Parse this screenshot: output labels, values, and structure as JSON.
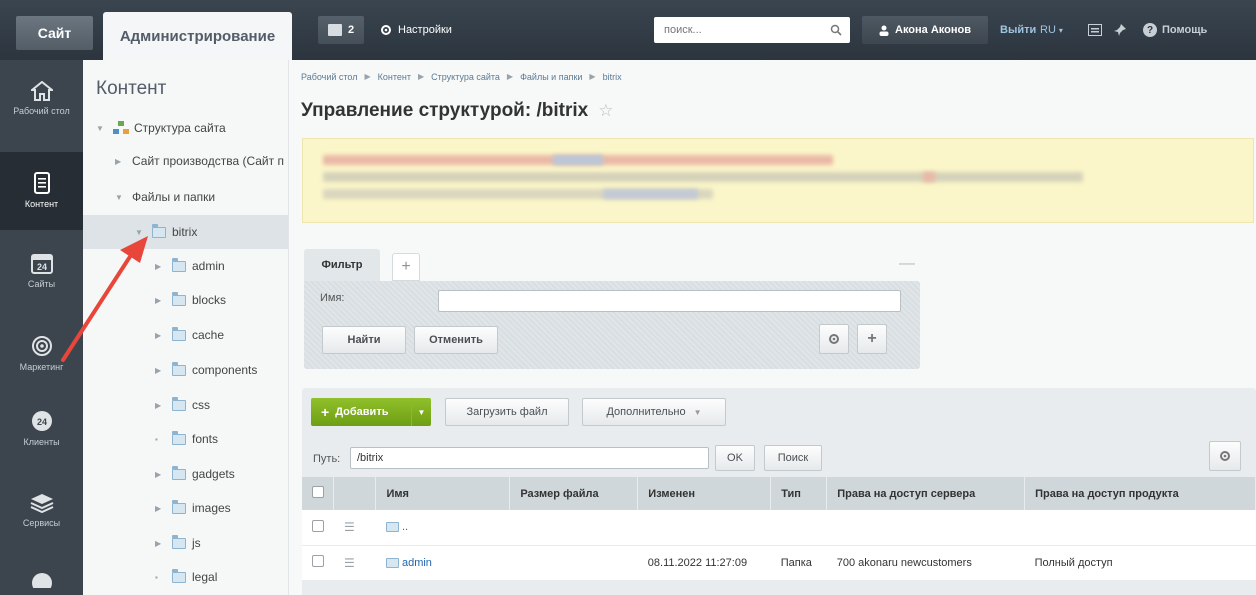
{
  "topbar": {
    "site_tab": "Сайт",
    "admin_tab": "Администрирование",
    "notifications_count": "2",
    "settings_label": "Настройки",
    "search_placeholder": "поиск...",
    "user_name": "Акона Аконов",
    "logout_label": "Выйти",
    "lang_label": "RU",
    "help_label": "Помощь"
  },
  "nav": {
    "items": [
      {
        "label": "Рабочий стол",
        "icon": "home-icon"
      },
      {
        "label": "Контент",
        "icon": "document-icon"
      },
      {
        "label": "Сайты",
        "icon": "calendar-icon"
      },
      {
        "label": "Маркетинг",
        "icon": "target-icon"
      },
      {
        "label": "Клиенты",
        "icon": "clients-icon"
      },
      {
        "label": "Сервисы",
        "icon": "layers-icon"
      }
    ]
  },
  "tree": {
    "title": "Контент",
    "items": [
      {
        "label": "Структура сайта"
      },
      {
        "label": "Сайт производства (Сайт п"
      },
      {
        "label": "Файлы и папки"
      },
      {
        "label": "bitrix"
      },
      {
        "label": "admin"
      },
      {
        "label": "blocks"
      },
      {
        "label": "cache"
      },
      {
        "label": "components"
      },
      {
        "label": "css"
      },
      {
        "label": "fonts"
      },
      {
        "label": "gadgets"
      },
      {
        "label": "images"
      },
      {
        "label": "js"
      },
      {
        "label": "legal"
      }
    ]
  },
  "breadcrumbs": [
    "Рабочий стол",
    "Контент",
    "Структура сайта",
    "Файлы и папки",
    "bitrix"
  ],
  "page_title": "Управление структурой: /bitrix",
  "filter": {
    "tab_label": "Фильтр",
    "add_tab": "+",
    "name_label": "Имя:",
    "name_value": "",
    "find_button": "Найти",
    "cancel_button": "Отменить"
  },
  "toolbar": {
    "add_button": "Добавить",
    "upload_button": "Загрузить файл",
    "more_button": "Дополнительно"
  },
  "path": {
    "label": "Путь:",
    "value": "/bitrix",
    "ok_button": "OK",
    "search_button": "Поиск"
  },
  "table": {
    "columns": [
      "Имя",
      "Размер файла",
      "Изменен",
      "Тип",
      "Права на доступ сервера",
      "Права на доступ продукта"
    ],
    "up_row": "..",
    "rows": [
      {
        "name": "admin",
        "size": "",
        "modified": "08.11.2022 11:27:09",
        "type": "Папка",
        "server_rights": "700 akonaru newcustomers",
        "product_rights": "Полный доступ"
      }
    ]
  },
  "colors": {
    "topbar": "#2c353e",
    "sidebar": "#3c454e",
    "accent_green": "#7fb01e",
    "link": "#2067b0",
    "annotation_arrow": "#e8463a"
  }
}
